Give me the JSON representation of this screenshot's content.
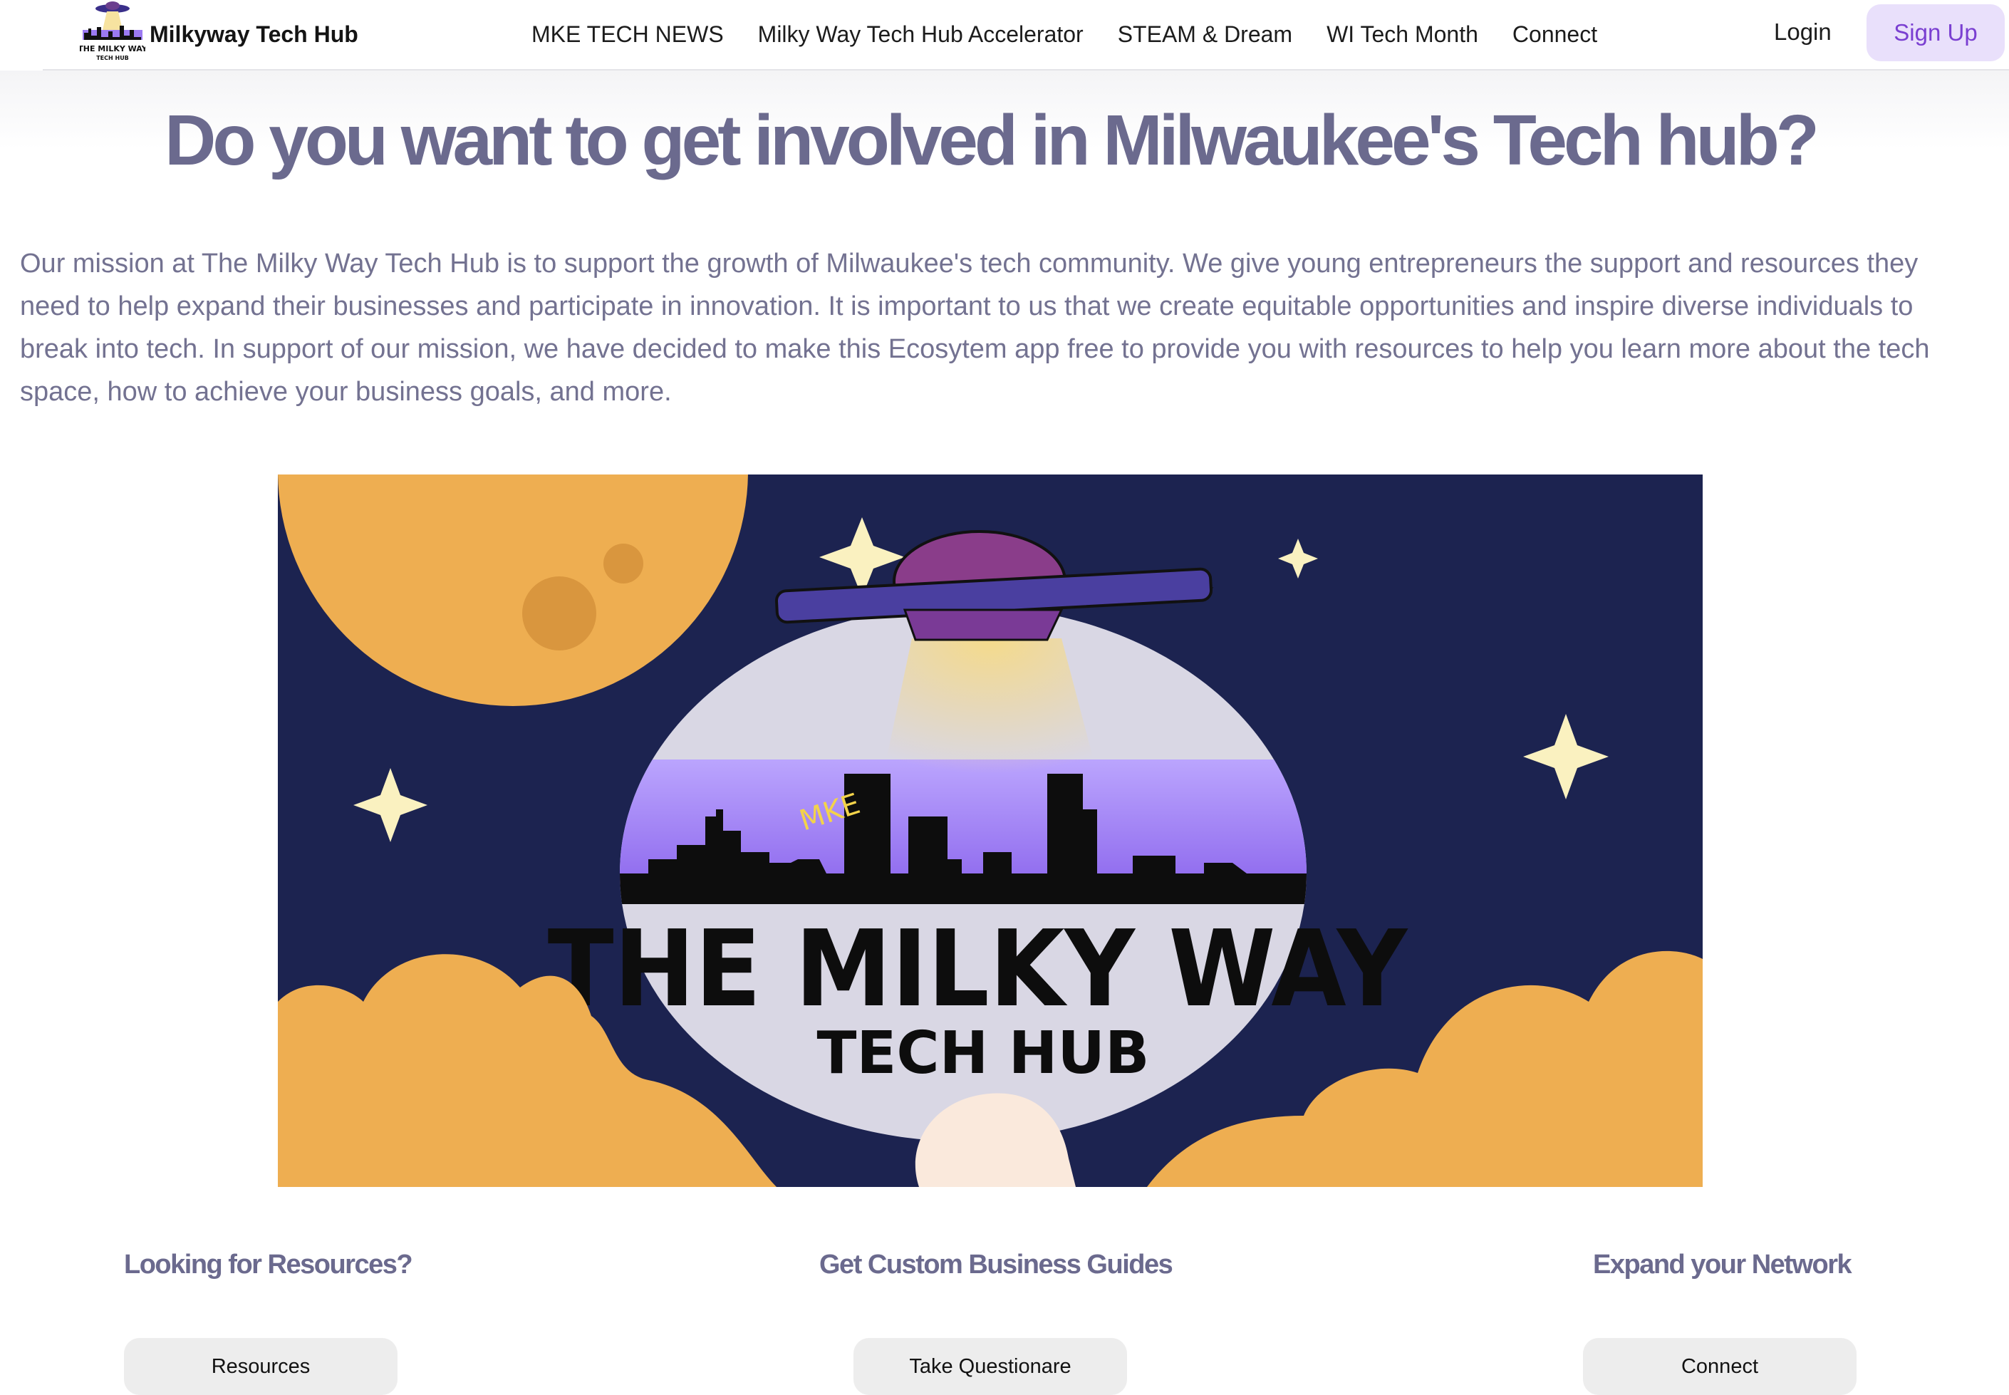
{
  "nav": {
    "brand_name": "Milkyway Tech Hub",
    "brand_logo_text_1": "THE MILKY WAY",
    "brand_logo_text_2": "TECH HUB",
    "links": [
      "MKE TECH NEWS",
      "Milky Way Tech Hub Accelerator",
      "STEAM & Dream",
      "WI Tech Month",
      "Connect"
    ],
    "login": "Login",
    "signup": "Sign Up"
  },
  "hero": {
    "headline": "Do you want to get involved in Milwaukee's Tech hub?",
    "mission": "Our mission at The Milky Way Tech Hub is to support the growth of Milwaukee's tech community. We give young entrepreneurs the support and resources they need to help expand their businesses and participate in innovation. It is important to us that we create equitable opportunities and inspire diverse individuals to break into tech. In support of our mission, we have decided to make this Ecosytem app free to provide you with resources to help you learn more about the tech space, how to achieve your business goals, and more.",
    "image_text_1": "THE MILKY WAY",
    "image_text_2": "TECH HUB",
    "image_text_mke": "MKE"
  },
  "features": [
    {
      "title": "Looking for Resources?",
      "button": "Resources"
    },
    {
      "title": "Get Custom Business Guides",
      "button": "Take Questionare"
    },
    {
      "title": "Expand your Network",
      "button": "Connect"
    }
  ],
  "colors": {
    "heading": "#6b6a8e",
    "signup_bg": "#e9e0fb",
    "signup_text": "#7a3fd1",
    "hero_night": "#1c2350",
    "hero_moon": "#eeae51",
    "hero_city_glow": "#9b7af2"
  }
}
